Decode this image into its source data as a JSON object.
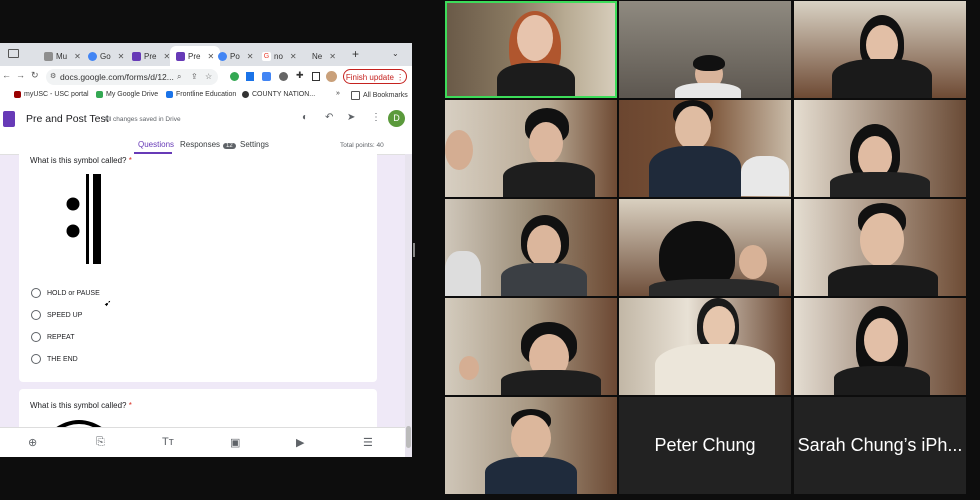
{
  "browser": {
    "tabs": [
      {
        "label": "Mu",
        "color": "#8e8e8e"
      },
      {
        "label": "Go",
        "color": "#4285f4"
      },
      {
        "label": "Pre",
        "color": "#673ab7"
      },
      {
        "label": "Pre",
        "color": "#673ab7"
      },
      {
        "label": "Po",
        "color": "#4285f4"
      },
      {
        "label": "no",
        "color": "#ea4335"
      },
      {
        "label": "Ne",
        "color": "#8e8e8e"
      }
    ],
    "new_tab": "+",
    "url": "docs.google.com/forms/d/12...",
    "finish_update": "Finish update",
    "bookmarks": [
      {
        "label": "myUSC - USC portal",
        "color": "#990000"
      },
      {
        "label": "My Google Drive",
        "color": "#34a853"
      },
      {
        "label": "Frontline Education",
        "color": "#1a73e8"
      },
      {
        "label": "COUNTY NATION...",
        "color": "#333333"
      }
    ],
    "bookmarks_more": "»",
    "all_bookmarks": "All Bookmarks"
  },
  "form": {
    "title": "Pre and Post Test",
    "saved_status": "All changes saved in Drive",
    "avatar_letter": "D",
    "tabs": {
      "questions": "Questions",
      "responses": "Responses",
      "responses_count": "12",
      "settings": "Settings"
    },
    "total_points": "Total points: 40",
    "question1": {
      "title": "What is this symbol called?",
      "required_mark": "*",
      "options": [
        "HOLD or PAUSE",
        "SPEED UP",
        "REPEAT",
        "THE END"
      ]
    },
    "question2": {
      "title": "What is this symbol called?",
      "required_mark": "*"
    }
  },
  "participants": {
    "peter": "Peter Chung",
    "sarah": "Sarah Chung’s iPh..."
  }
}
